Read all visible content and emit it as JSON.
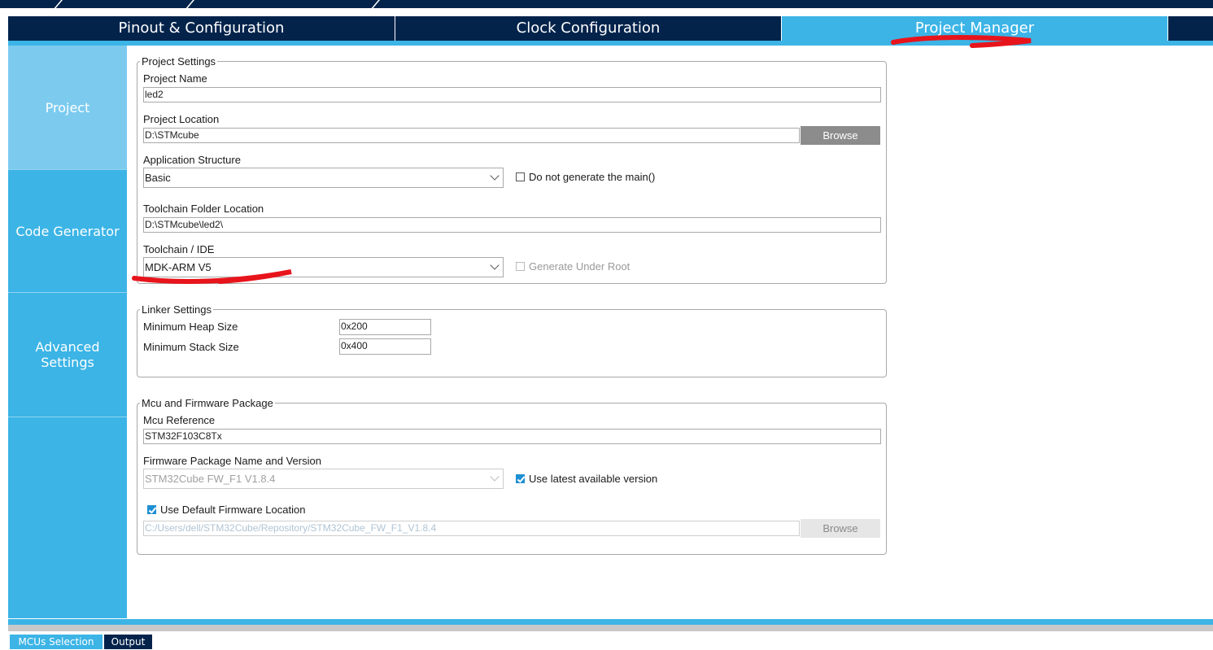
{
  "tabs": {
    "pinout": "Pinout & Configuration",
    "clock": "Clock Configuration",
    "project_manager": "Project Manager"
  },
  "sidebar": {
    "items": [
      {
        "label": "Project"
      },
      {
        "label": "Code Generator"
      },
      {
        "label": "Advanced Settings"
      }
    ]
  },
  "project_settings": {
    "legend": "Project Settings",
    "name_label": "Project Name",
    "name_value": "led2",
    "location_label": "Project Location",
    "location_value": "D:\\STMcube",
    "browse_label": "Browse",
    "app_structure_label": "Application Structure",
    "app_structure_value": "Basic",
    "no_main_label": "Do not generate the main()",
    "toolchain_folder_label": "Toolchain Folder Location",
    "toolchain_folder_value": "D:\\STMcube\\led2\\",
    "toolchain_ide_label": "Toolchain / IDE",
    "toolchain_ide_value": "MDK-ARM V5",
    "generate_under_root_label": "Generate Under Root"
  },
  "linker_settings": {
    "legend": "Linker Settings",
    "heap_label": "Minimum Heap Size",
    "heap_value": "0x200",
    "stack_label": "Minimum Stack Size",
    "stack_value": "0x400"
  },
  "mcu_firmware": {
    "legend": "Mcu and Firmware Package",
    "mcu_ref_label": "Mcu Reference",
    "mcu_ref_value": "STM32F103C8Tx",
    "fw_label": "Firmware Package Name and Version",
    "fw_value": "STM32Cube FW_F1 V1.8.4",
    "use_latest_label": "Use latest available version",
    "use_default_label": "Use Default Firmware Location",
    "fw_location_value": "C:/Users/dell/STM32Cube/Repository/STM32Cube_FW_F1_V1.8.4",
    "browse_label": "Browse"
  },
  "bottom_tabs": {
    "mcus_selection": "MCUs Selection",
    "output": "Output"
  },
  "colors": {
    "dark_navy": "#03234b",
    "accent_blue": "#3cb4e6",
    "sidebar_active": "#7ccbef",
    "annotation_red": "#e8141b"
  },
  "checkboxes": {
    "do_not_generate_main": false,
    "generate_under_root": false,
    "use_latest_version": true,
    "use_default_fw_location": true
  }
}
